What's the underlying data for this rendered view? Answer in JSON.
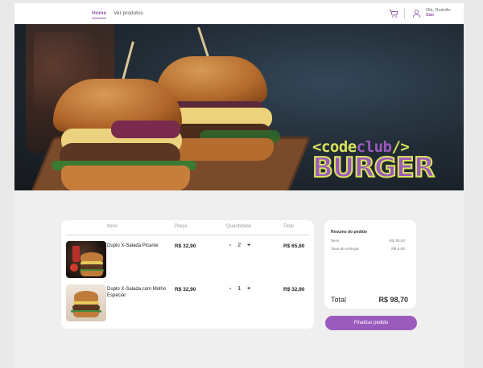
{
  "header": {
    "nav": {
      "home": "Home",
      "products": "Ver produtos"
    },
    "user": {
      "greeting": "Olá, Rodolfo",
      "logout": "Sair"
    }
  },
  "banner": {
    "brand_line1_a": "<code",
    "brand_line1_b": "club",
    "brand_line1_c": "/>",
    "brand_line2": "BURGER",
    "colors": {
      "lime": "#dbe35a",
      "purple": "#9b5bbd"
    }
  },
  "cart": {
    "headers": {
      "items": "Itens",
      "price": "Preço",
      "quantity": "Quantidade",
      "total": "Total"
    },
    "rows": [
      {
        "name": "Duplo X-Salada Picante",
        "price": "R$ 32,90",
        "quantity": "2",
        "total": "R$ 65,80",
        "minus": "-",
        "plus": "+"
      },
      {
        "name": "Duplo X-Salada com Molho Especial",
        "price": "R$ 32,90",
        "quantity": "1",
        "total": "R$ 32,90",
        "minus": "-",
        "plus": "+"
      }
    ]
  },
  "summary": {
    "title": "Resumo do pedido",
    "items_label": "Itens",
    "items_value": "R$ 30,00",
    "fee_label": "Taxa de entrega",
    "fee_value": "R$ 5,00",
    "total_label": "Total",
    "total_value": "R$ 98,70",
    "finish_label": "Finalizar pedido"
  },
  "icons": {
    "cart": "cart-icon",
    "user": "user-icon"
  },
  "colors": {
    "accent": "#9758a6",
    "button": "#9b5bbd"
  }
}
